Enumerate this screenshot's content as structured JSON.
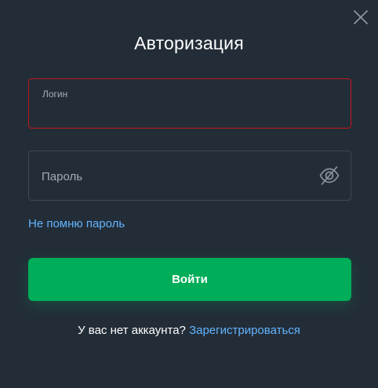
{
  "modal": {
    "title": "Авторизация",
    "close_icon": "close-icon"
  },
  "login_field": {
    "label": "Логин",
    "value": "",
    "border_color": "#c3161c"
  },
  "password_field": {
    "placeholder": "Пароль",
    "value": "",
    "visibility_icon": "eye-slash-icon"
  },
  "forgot_link": {
    "label": "Не помню пароль"
  },
  "submit_button": {
    "label": "Войти",
    "color": "#00ad59"
  },
  "register": {
    "text": "У вас нет аккаунта?",
    "link_label": "Зарегистрироваться"
  },
  "colors": {
    "background": "#232d37",
    "link": "#63b4ff",
    "error": "#c3161c",
    "accent": "#00ad59"
  }
}
